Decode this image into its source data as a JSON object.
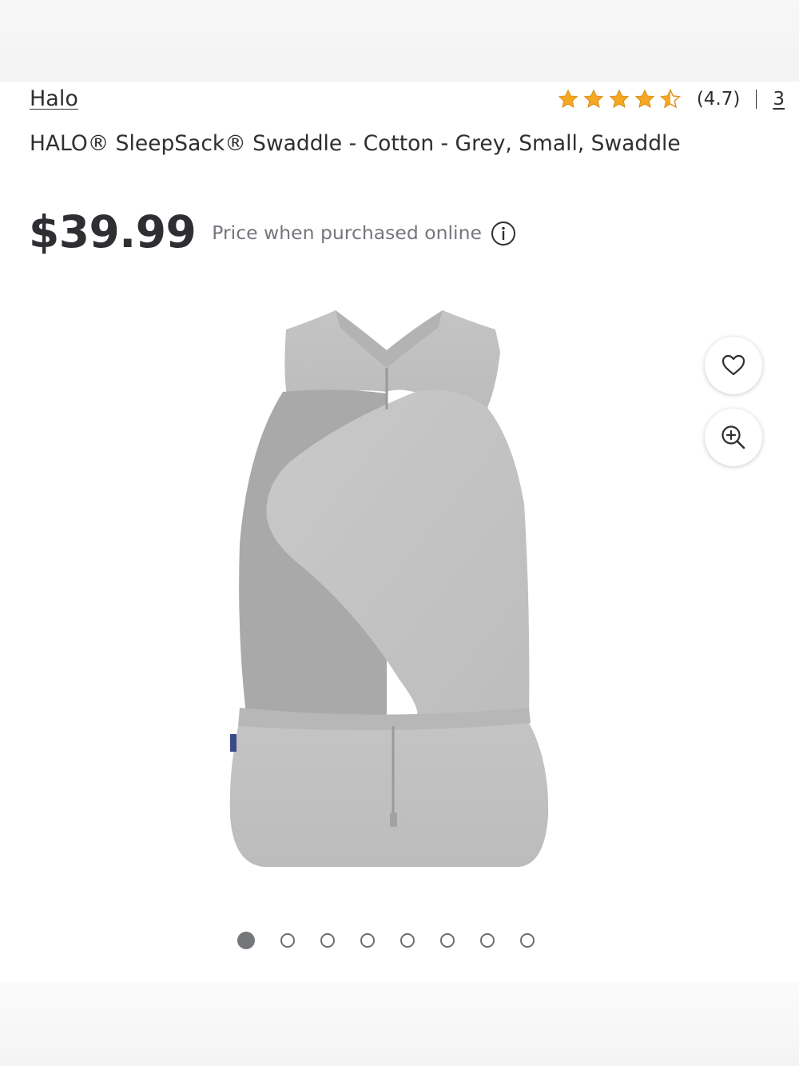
{
  "product": {
    "brand": "Halo",
    "title": "HALO® SleepSack® Swaddle - Cotton - Grey, Small, Swaddle",
    "price": "$39.99",
    "price_note": "Price when purchased online"
  },
  "rating": {
    "value": "(4.7)",
    "stars": 4.7,
    "review_count": "3",
    "star_color": "#f5a623"
  },
  "gallery": {
    "image_icon": "swaddle-product-photo",
    "page_count": 8,
    "active_index": 0,
    "favorite_icon": "heart-icon",
    "zoom_icon": "zoom-in-icon"
  }
}
